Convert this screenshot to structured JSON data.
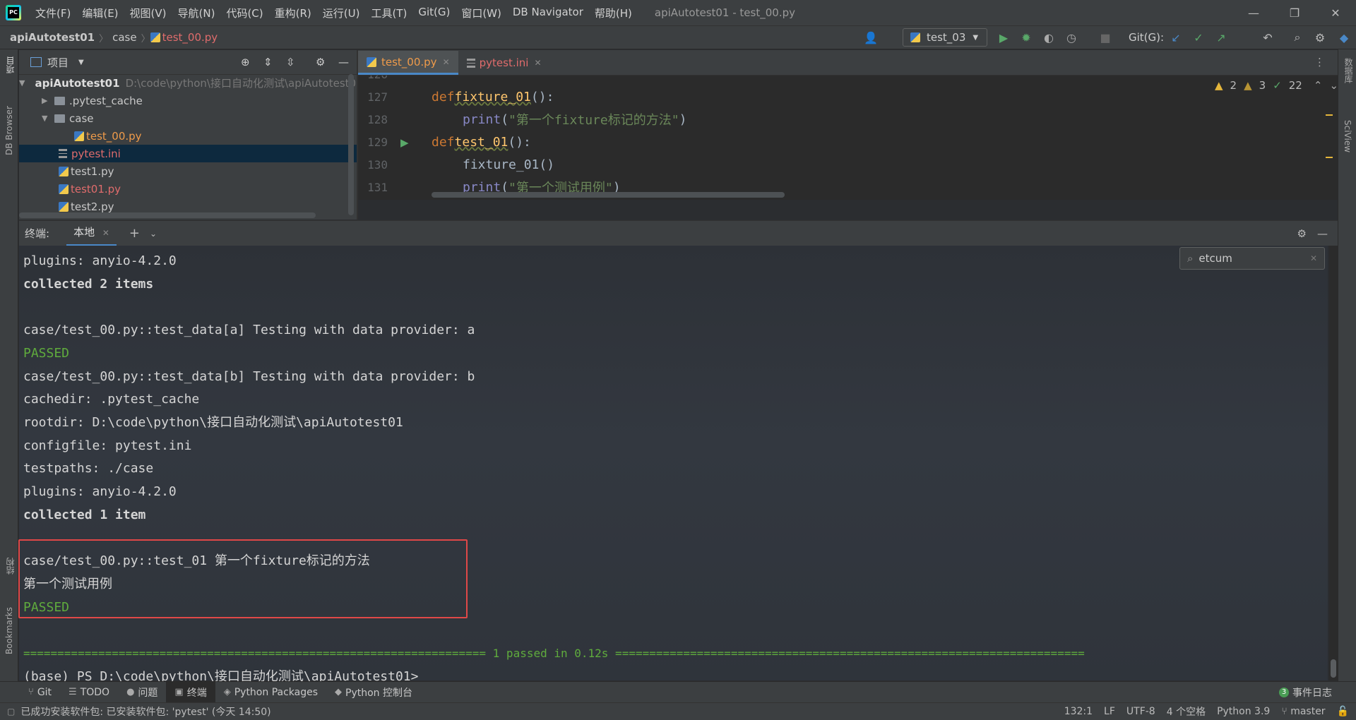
{
  "menu": [
    "文件(F)",
    "编辑(E)",
    "视图(V)",
    "导航(N)",
    "代码(C)",
    "重构(R)",
    "运行(U)",
    "工具(T)",
    "Git(G)",
    "窗口(W)",
    "DB Navigator",
    "帮助(H)"
  ],
  "window_title": "apiAutotest01 - test_00.py",
  "breadcrumb": {
    "project": "apiAutotest01",
    "folder": "case",
    "file": "test_00.py"
  },
  "run_config": "test_03",
  "git_label": "Git(G):",
  "project_panel": {
    "title": "项目",
    "root_name": "apiAutotest01",
    "root_path": "D:\\code\\python\\接口自动化测试\\apiAutotest01",
    "items": [
      {
        "name": ".pytest_cache",
        "color": "normal"
      },
      {
        "name": "case",
        "color": "normal"
      },
      {
        "name": "test_00.py",
        "color": "orange"
      },
      {
        "name": "pytest.ini",
        "color": "red"
      },
      {
        "name": "test1.py",
        "color": "normal"
      },
      {
        "name": "test01.py",
        "color": "red"
      },
      {
        "name": "test2.py",
        "color": "normal"
      }
    ]
  },
  "editor": {
    "tabs": [
      "test_00.py",
      "pytest.ini"
    ],
    "lines": [
      {
        "num": "126",
        "text": ""
      },
      {
        "num": "127",
        "kw": "def ",
        "fn": "fixture_01",
        "rest": "():"
      },
      {
        "num": "128",
        "indent": true,
        "bi": "print",
        "open": "(",
        "str": "\"第一个fixture标记的方法\"",
        "close": ")"
      },
      {
        "num": "129",
        "kw": "def ",
        "fn": "test_01",
        "rest": "():"
      },
      {
        "num": "130",
        "indent": true,
        "plain": "fixture_01()"
      },
      {
        "num": "131",
        "indent": true,
        "bi": "print",
        "open": "(",
        "str": "\"第一个测试用例\"",
        "close": ")"
      }
    ],
    "inspections": {
      "warnings": "2",
      "weak_warnings": "3",
      "ok": "22"
    }
  },
  "terminal": {
    "label": "终端:",
    "tab": "本地",
    "search_value": "etcum",
    "lines": [
      {
        "text": "plugins: anyio-4.2.0",
        "style": "normal"
      },
      {
        "text": "collected 2 items",
        "style": "bold"
      },
      {
        "text": "",
        "style": "normal"
      },
      {
        "text": "case/test_00.py::test_data[a] Testing with data provider: a",
        "style": "normal"
      },
      {
        "text": "PASSED",
        "style": "green"
      },
      {
        "text": "case/test_00.py::test_data[b] Testing with data provider: b",
        "style": "normal"
      },
      {
        "text": "cachedir: .pytest_cache",
        "style": "normal"
      },
      {
        "text": "rootdir: D:\\code\\python\\接口自动化测试\\apiAutotest01",
        "style": "normal"
      },
      {
        "text": "configfile: pytest.ini",
        "style": "normal"
      },
      {
        "text": "testpaths: ./case",
        "style": "normal"
      },
      {
        "text": "plugins: anyio-4.2.0",
        "style": "normal"
      },
      {
        "text": "collected 1 item",
        "style": "bold"
      },
      {
        "text": "",
        "style": "normal"
      },
      {
        "text": "case/test_00.py::test_01 第一个fixture标记的方法",
        "style": "normal"
      },
      {
        "text": "第一个测试用例",
        "style": "normal"
      },
      {
        "text": "PASSED",
        "style": "green"
      },
      {
        "text": "",
        "style": "normal"
      },
      {
        "text": "==================================================================== 1 passed in 0.12s =====================================================================",
        "style": "green-bold"
      },
      {
        "text": "(base) PS D:\\code\\python\\接口自动化测试\\apiAutotest01>",
        "style": "normal"
      }
    ]
  },
  "bottom_tools": [
    "Git",
    "TODO",
    "问题",
    "终端",
    "Python Packages",
    "Python 控制台"
  ],
  "event_log": {
    "count": "3",
    "label": "事件日志"
  },
  "status": {
    "message": "已成功安装软件包: 已安装软件包: 'pytest' (今天 14:50)",
    "position": "132:1",
    "line_sep": "LF",
    "encoding": "UTF-8",
    "indent": "4 个空格",
    "interpreter": "Python 3.9",
    "branch": "master"
  },
  "side_labels": {
    "left_top": "项目",
    "left_db": "DB Browser",
    "left_struct": "结构",
    "left_bookmarks": "Bookmarks",
    "right_db": "数据库",
    "right_sci": "SciView"
  }
}
